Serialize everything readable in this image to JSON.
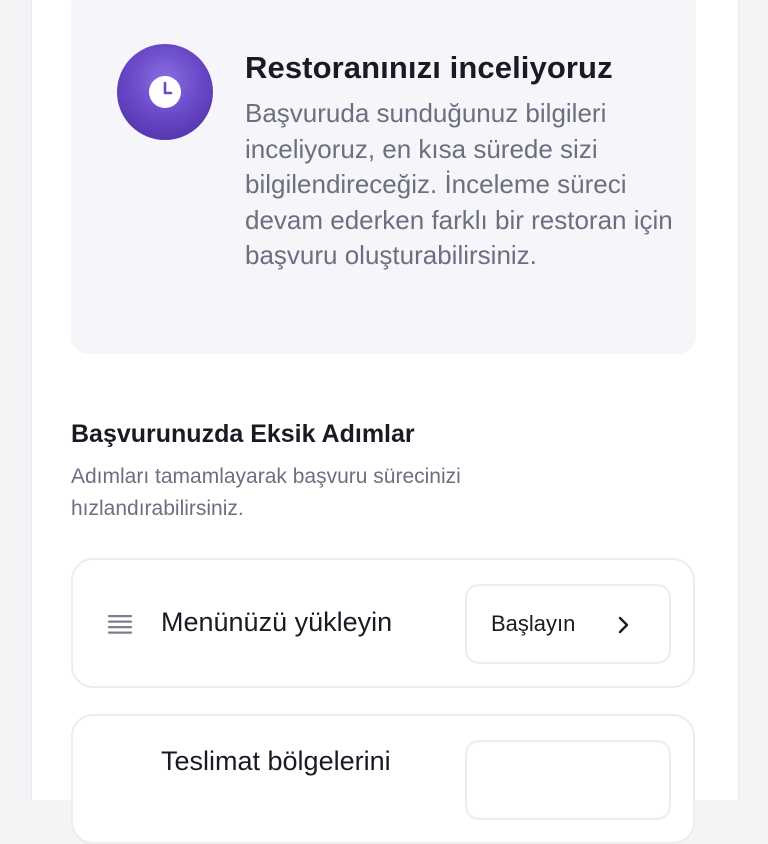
{
  "review": {
    "icon": "clock-icon",
    "title": "Restoranınızı inceliyoruz",
    "description": "Başvuruda sunduğunuz bilgileri inceliyoruz, en kısa sürede sizi bilgilendireceğiz. İnceleme süreci devam ederken farklı bir restoran için başvuru oluşturabilirsiniz."
  },
  "missing_steps": {
    "title": "Başvurunuzda Eksik Adımlar",
    "description": "Adımları tamamlayarak başvuru sürecinizi hızlandırabilirsiniz.",
    "steps": [
      {
        "icon": "menu-list-icon",
        "label": "Menünüzü yükleyin",
        "button_label": "Başlayın",
        "button_icon": "chevron-right-icon"
      },
      {
        "label": "Teslimat bölgelerini"
      }
    ]
  },
  "colors": {
    "accent": "#6a4ac9",
    "text_primary": "#1a1a24",
    "text_secondary": "#6b6f80",
    "card_background": "#f6f6fa",
    "border": "#ececf1"
  }
}
